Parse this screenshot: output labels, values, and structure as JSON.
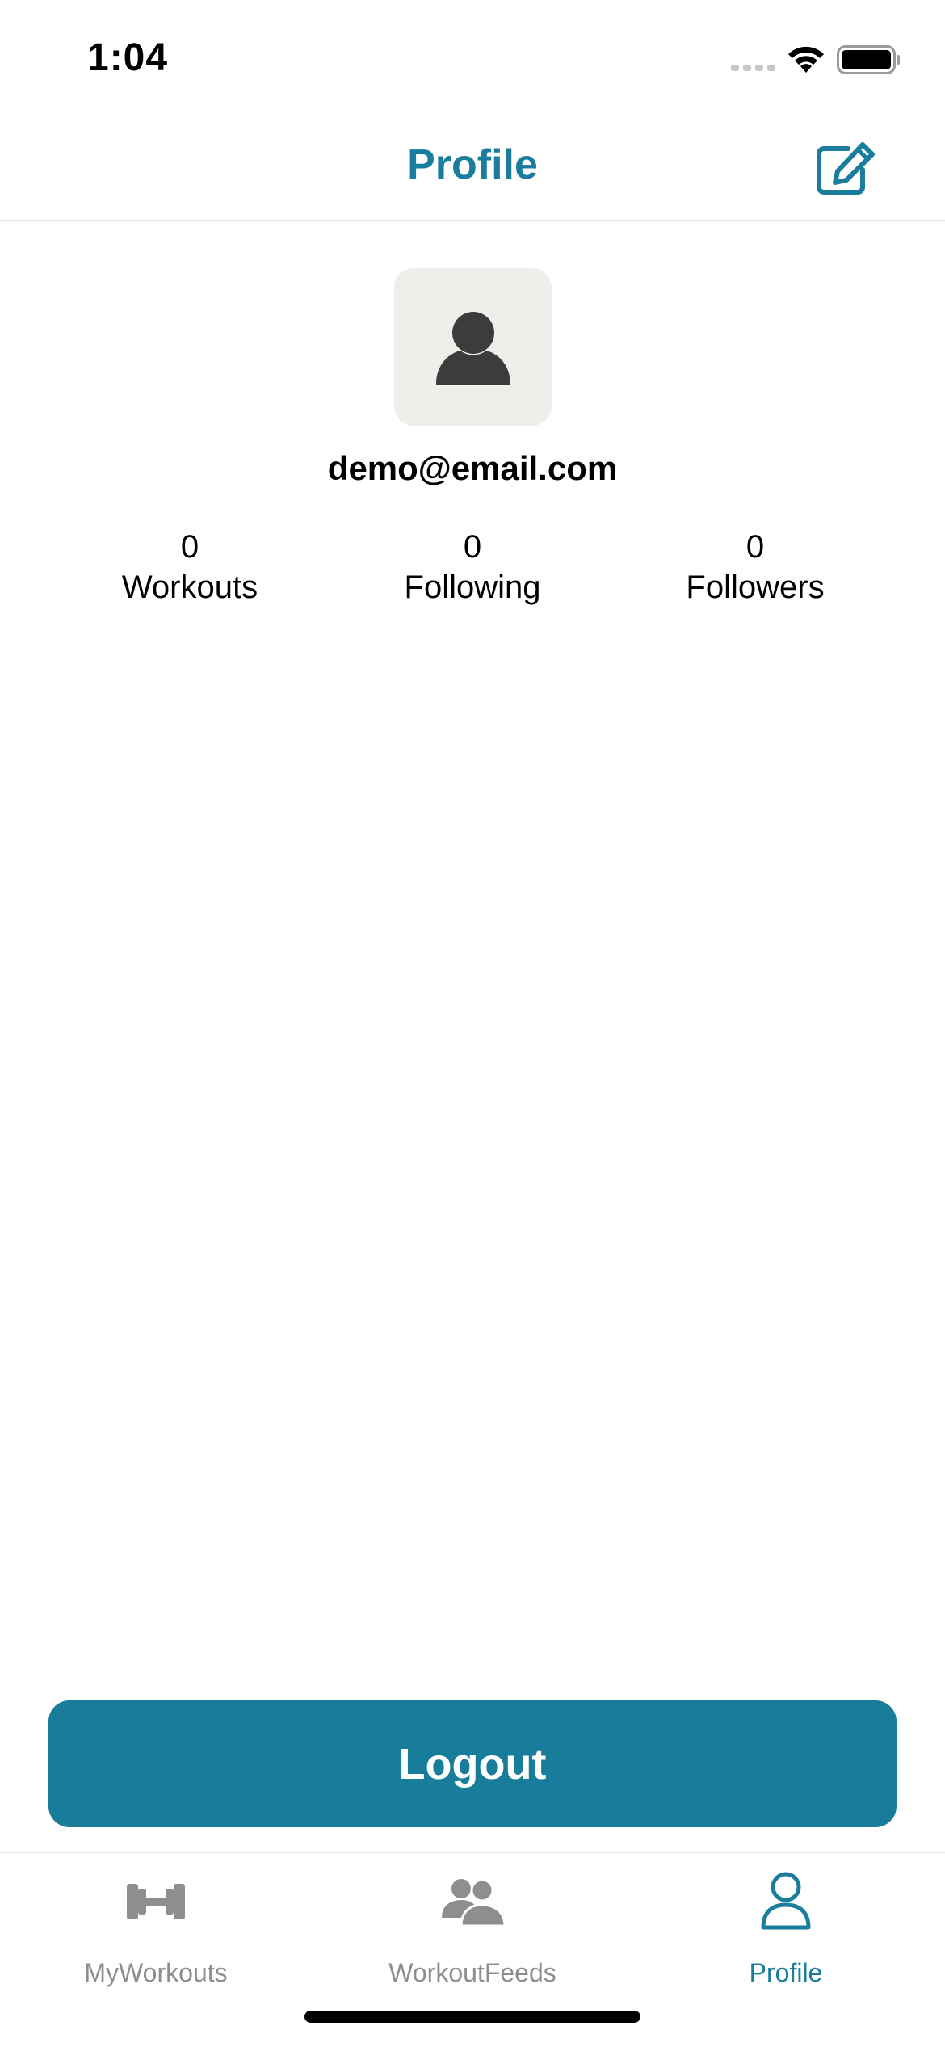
{
  "status_bar": {
    "time": "1:04"
  },
  "nav": {
    "title": "Profile",
    "edit_icon": "edit-square-icon"
  },
  "profile": {
    "avatar_icon": "person-icon",
    "email": "demo@email.com",
    "stats": [
      {
        "value": "0",
        "label": "Workouts"
      },
      {
        "value": "0",
        "label": "Following"
      },
      {
        "value": "0",
        "label": "Followers"
      }
    ]
  },
  "actions": {
    "logout_label": "Logout"
  },
  "tab_bar": {
    "tabs": [
      {
        "label": "MyWorkouts",
        "icon": "dumbbell-icon",
        "active": false
      },
      {
        "label": "WorkoutFeeds",
        "icon": "people-icon",
        "active": false
      },
      {
        "label": "Profile",
        "icon": "person-outline-icon",
        "active": true
      }
    ]
  },
  "colors": {
    "accent": "#1a7d9d",
    "button": "#187c9b",
    "inactive_tab": "#8e8e8e",
    "avatar_bg": "#efeeea"
  }
}
